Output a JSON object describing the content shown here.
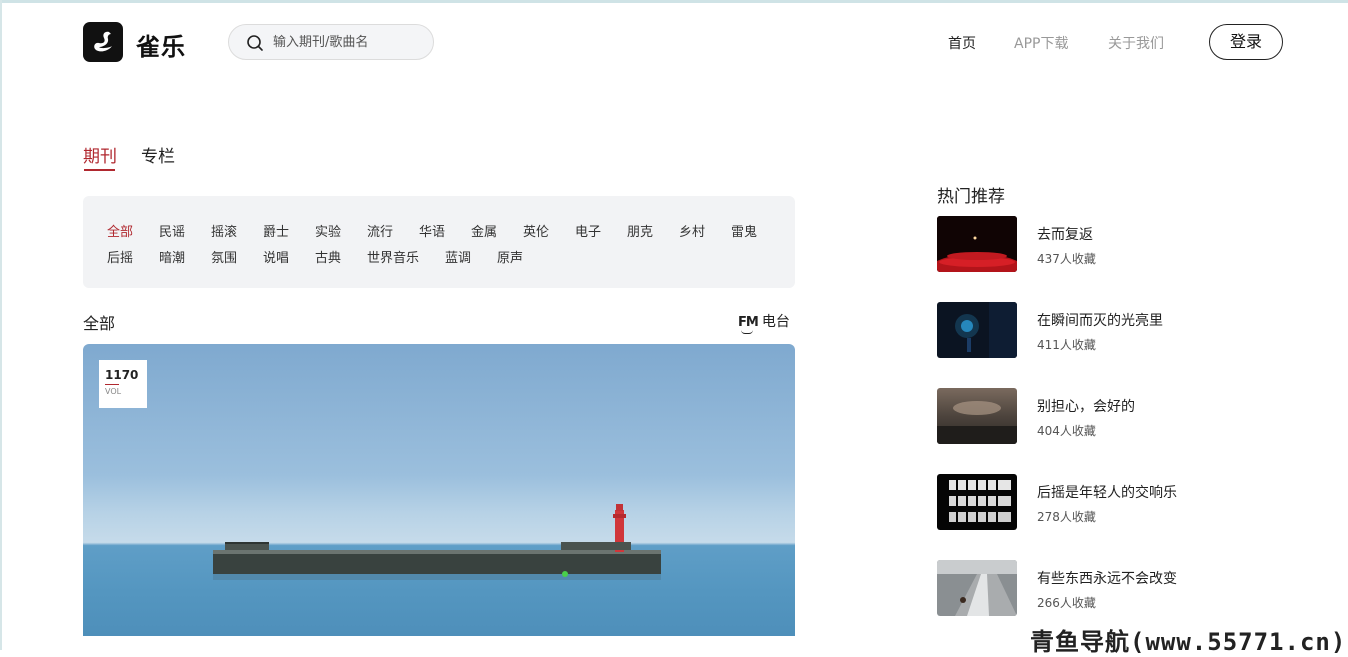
{
  "brand": {
    "name": "雀乐"
  },
  "search": {
    "placeholder": "输入期刊/歌曲名"
  },
  "nav": {
    "home": "首页",
    "app": "APP下载",
    "about": "关于我们",
    "login": "登录"
  },
  "tabs": [
    "期刊",
    "专栏"
  ],
  "categories": [
    "全部",
    "民谣",
    "摇滚",
    "爵士",
    "实验",
    "流行",
    "华语",
    "金属",
    "英伦",
    "电子",
    "朋克",
    "乡村",
    "雷鬼",
    "后摇",
    "暗潮",
    "氛围",
    "说唱",
    "古典",
    "世界音乐",
    "蓝调",
    "原声"
  ],
  "section": {
    "title": "全部",
    "radio_icon": "FM",
    "radio_label": "电台"
  },
  "banner": {
    "vol_number": "1170",
    "vol_label": "VOL"
  },
  "hot": {
    "title": "热门推荐",
    "items": [
      {
        "name": "去而复返",
        "count": "437人收藏"
      },
      {
        "name": "在瞬间而灭的光亮里",
        "count": "411人收藏"
      },
      {
        "name": "别担心，会好的",
        "count": "404人收藏"
      },
      {
        "name": "后摇是年轻人的交响乐",
        "count": "278人收藏"
      },
      {
        "name": "有些东西永远不会改变",
        "count": "266人收藏"
      }
    ]
  },
  "watermark": "青鱼导航(www.55771.cn)",
  "colors": {
    "accent": "#b0282f",
    "category_bg": "#f2f3f5"
  }
}
